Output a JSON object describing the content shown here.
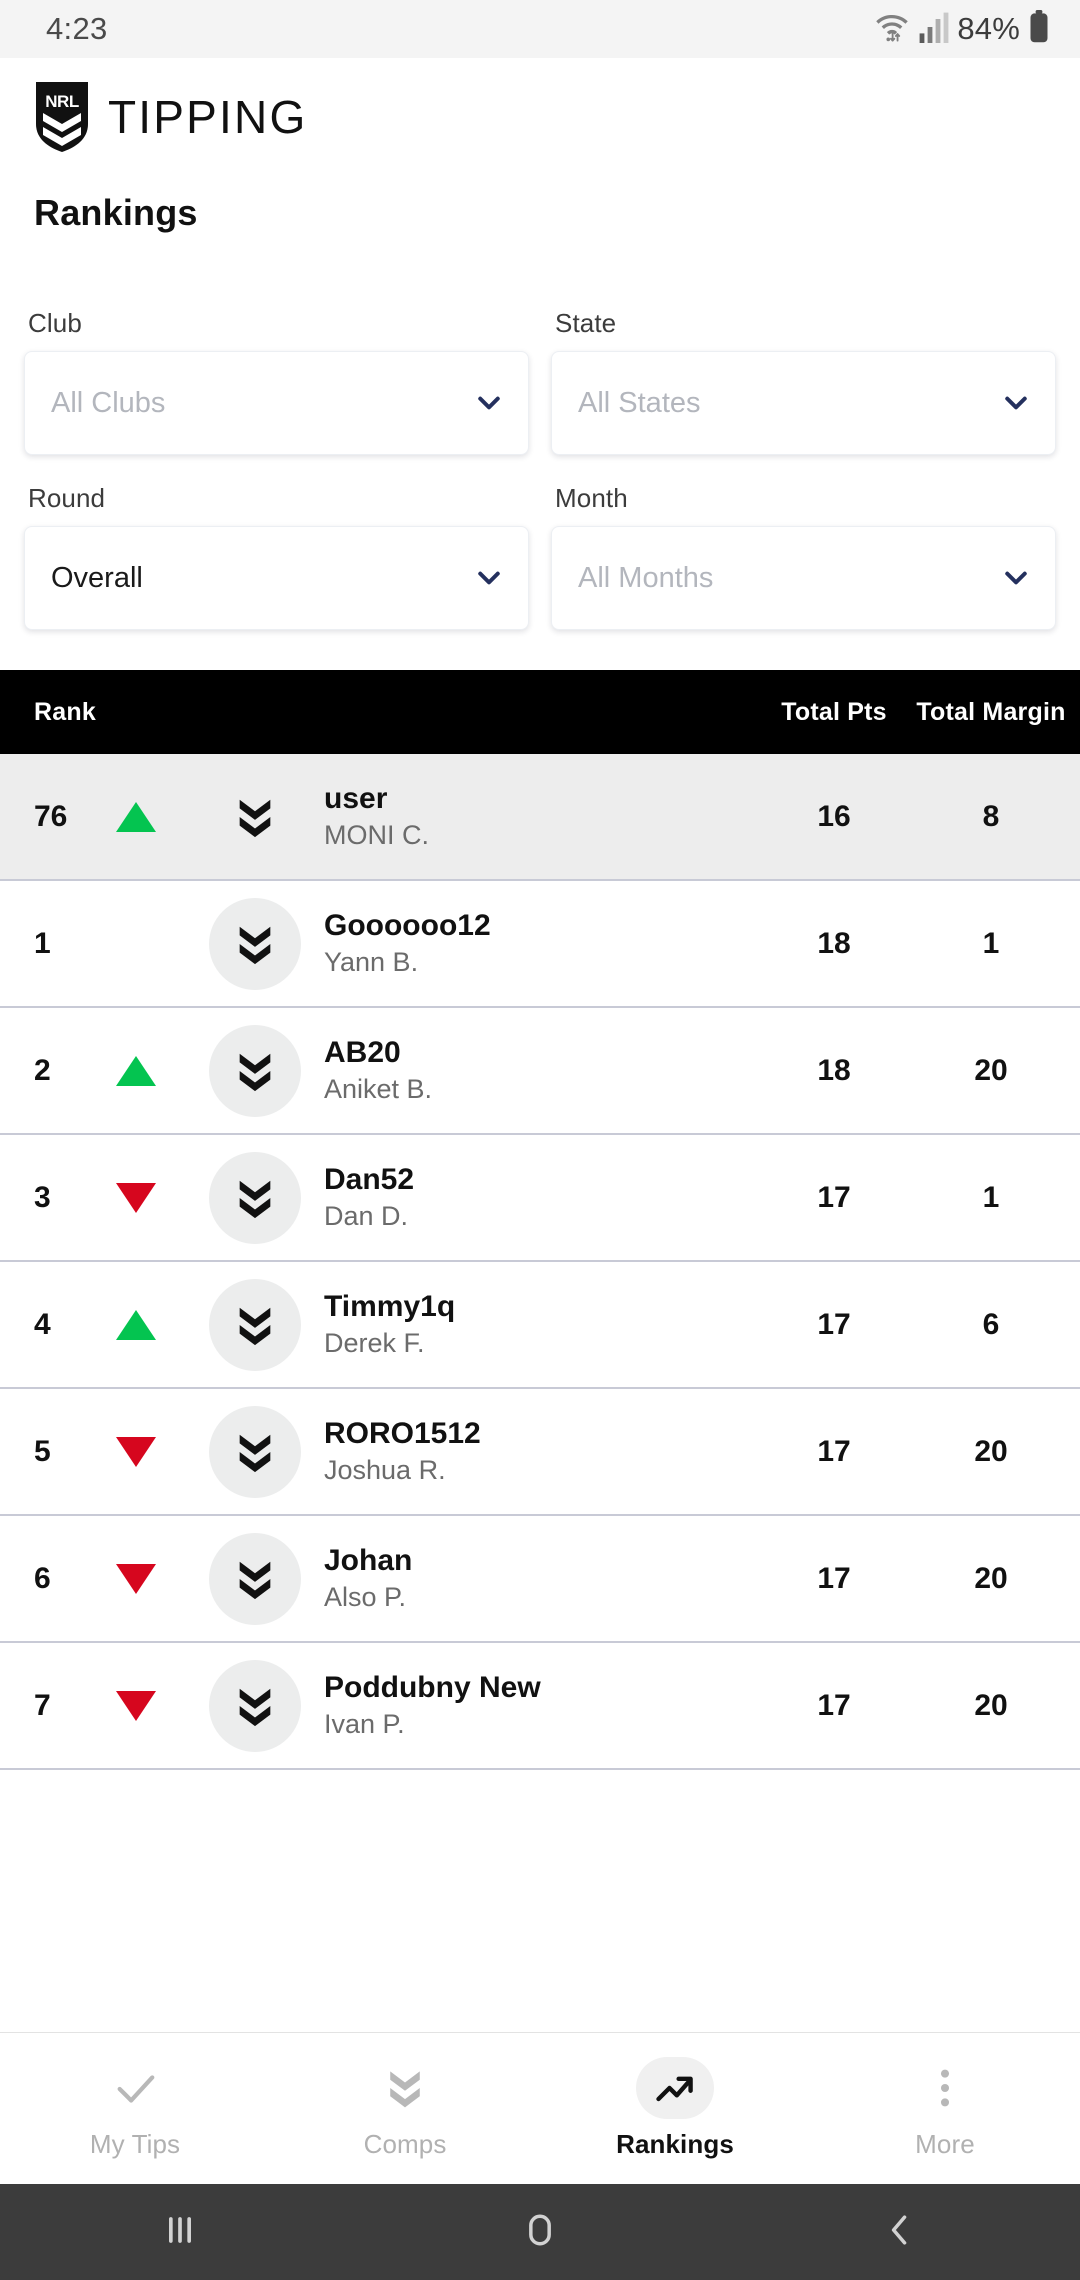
{
  "status_bar": {
    "time": "4:23",
    "battery_percent": "84%",
    "wifi_icon": "wifi-icon",
    "signal_icon": "signal-bars-icon",
    "battery_icon": "battery-icon"
  },
  "header": {
    "logo_text": "NRL",
    "brand": "TIPPING",
    "page_title": "Rankings"
  },
  "filters": [
    {
      "label": "Club",
      "value": "All Clubs",
      "is_placeholder": true,
      "name": "club"
    },
    {
      "label": "State",
      "value": "All States",
      "is_placeholder": true,
      "name": "state"
    },
    {
      "label": "Round",
      "value": "Overall",
      "is_placeholder": false,
      "name": "round"
    },
    {
      "label": "Month",
      "value": "All Months",
      "is_placeholder": true,
      "name": "month"
    }
  ],
  "table": {
    "headers": {
      "rank": "Rank",
      "total_pts": "Total Pts",
      "total_margin": "Total Margin"
    },
    "rows": [
      {
        "rank": "76",
        "movement": "up",
        "username": "user",
        "realname": "MONI C.",
        "total_pts": "16",
        "total_margin": "8",
        "is_current_user": true
      },
      {
        "rank": "1",
        "movement": "none",
        "username": "Goooooo12",
        "realname": "Yann B.",
        "total_pts": "18",
        "total_margin": "1",
        "is_current_user": false
      },
      {
        "rank": "2",
        "movement": "up",
        "username": "AB20",
        "realname": "Aniket B.",
        "total_pts": "18",
        "total_margin": "20",
        "is_current_user": false
      },
      {
        "rank": "3",
        "movement": "down",
        "username": "Dan52",
        "realname": "Dan D.",
        "total_pts": "17",
        "total_margin": "1",
        "is_current_user": false
      },
      {
        "rank": "4",
        "movement": "up",
        "username": "Timmy1q",
        "realname": "Derek F.",
        "total_pts": "17",
        "total_margin": "6",
        "is_current_user": false
      },
      {
        "rank": "5",
        "movement": "down",
        "username": "RORO1512",
        "realname": "Joshua R.",
        "total_pts": "17",
        "total_margin": "20",
        "is_current_user": false
      },
      {
        "rank": "6",
        "movement": "down",
        "username": "Johan",
        "realname": "Also P.",
        "total_pts": "17",
        "total_margin": "20",
        "is_current_user": false
      },
      {
        "rank": "7",
        "movement": "down",
        "username": "Poddubny New",
        "realname": "Ivan P.",
        "total_pts": "17",
        "total_margin": "20",
        "is_current_user": false
      }
    ]
  },
  "bottom_nav": {
    "items": [
      {
        "label": "My Tips",
        "icon": "check-icon",
        "active": false
      },
      {
        "label": "Comps",
        "icon": "double-chevron-icon",
        "active": false
      },
      {
        "label": "Rankings",
        "icon": "trending-up-icon",
        "active": true
      },
      {
        "label": "More",
        "icon": "three-dots-icon",
        "active": false
      }
    ]
  },
  "android_nav": {
    "recents": "recents-icon",
    "home": "home-icon",
    "back": "back-icon"
  },
  "colors": {
    "up": "#04c450",
    "down": "#d6061e",
    "header_bg": "#000000",
    "current_user_row": "#ededed",
    "chevron_accent": "#24305e"
  }
}
